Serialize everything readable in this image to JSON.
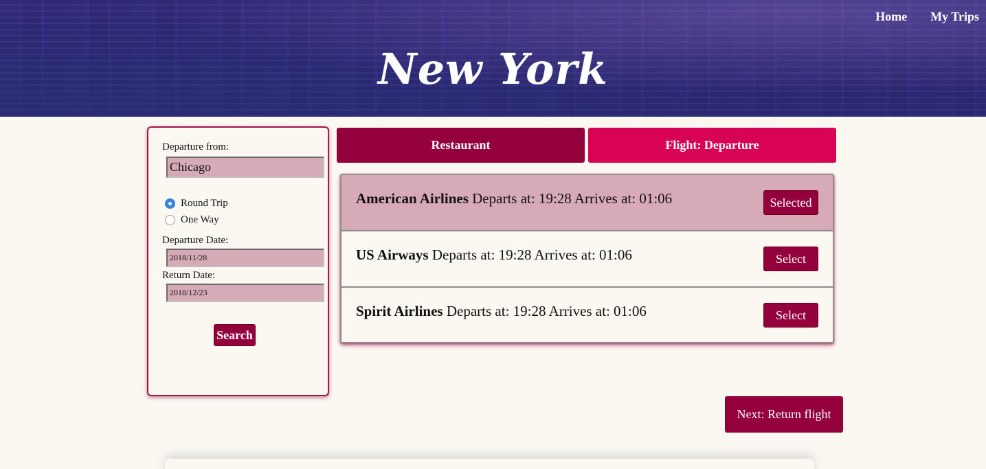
{
  "header": {
    "city_title": "New York",
    "nav": [
      {
        "label": "Home"
      },
      {
        "label": "My Trips"
      }
    ]
  },
  "search": {
    "departure_from_label": "Departure from:",
    "departure_from_value": "Chicago",
    "trip_types": [
      {
        "label": "Round Trip",
        "selected": true
      },
      {
        "label": "One Way",
        "selected": false
      }
    ],
    "departure_date_label": "Departure Date:",
    "departure_date_value": "2018/11/28",
    "return_date_label": "Return Date:",
    "return_date_value": "2018/12/23",
    "search_button": "Search"
  },
  "tabs": [
    {
      "label": "Restaurant",
      "color": "#93003b"
    },
    {
      "label": "Flight: Departure",
      "color": "#d80352"
    }
  ],
  "flights": [
    {
      "airline": "American Airlines",
      "details": " Departs at: 19:28 Arrives at: 01:06",
      "button": "Selected",
      "selected": true
    },
    {
      "airline": "US Airways",
      "details": " Departs at: 19:28 Arrives at: 01:06",
      "button": "Select",
      "selected": false
    },
    {
      "airline": "Spirit Airlines",
      "details": " Departs at: 19:28 Arrives at: 01:06",
      "button": "Select",
      "selected": false
    }
  ],
  "next_button": "Next: Return flight",
  "colors": {
    "primary": "#93003b",
    "accent": "#d80352",
    "highlight": "#d6aab6",
    "background": "#fbf8f2"
  }
}
